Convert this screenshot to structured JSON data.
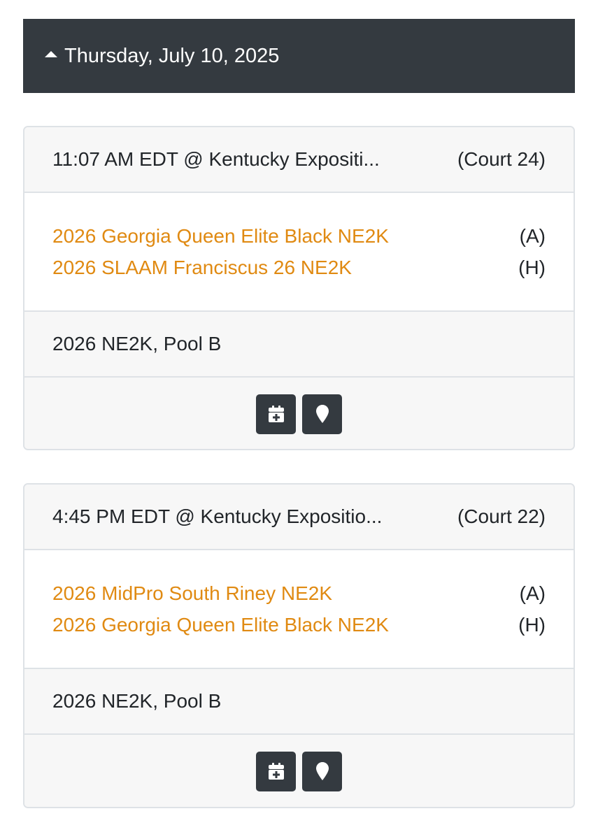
{
  "day_header": {
    "label": "Thursday, July 10, 2025"
  },
  "matches": [
    {
      "time_location": "11:07 AM EDT @ Kentucky Expositi...",
      "court": "(Court 24)",
      "teams": [
        {
          "name": "2026 Georgia Queen Elite Black NE2K",
          "side": "(A)"
        },
        {
          "name": "2026 SLAAM Franciscus 26 NE2K",
          "side": "(H)"
        }
      ],
      "pool": "2026 NE2K, Pool B",
      "actions": [
        "calendar-add-icon",
        "location-pin-icon"
      ]
    },
    {
      "time_location": "4:45 PM EDT @ Kentucky Expositio...",
      "court": "(Court 22)",
      "teams": [
        {
          "name": "2026 MidPro South Riney NE2K",
          "side": "(A)"
        },
        {
          "name": "2026 Georgia Queen Elite Black NE2K",
          "side": "(H)"
        }
      ],
      "pool": "2026 NE2K, Pool B",
      "actions": [
        "calendar-add-icon",
        "location-pin-icon"
      ]
    }
  ],
  "colors": {
    "header_bg": "#343a40",
    "team_link": "#e08a12",
    "card_border": "#dee2e6",
    "muted_bg": "#f7f7f7"
  }
}
